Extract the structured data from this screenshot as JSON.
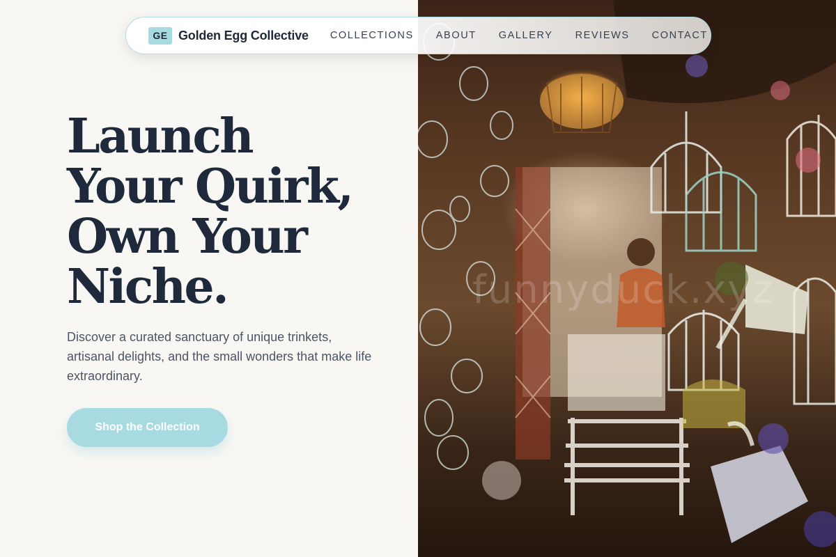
{
  "brand": {
    "logo_text": "GE",
    "name": "Golden Egg Collective",
    "accent_color": "#a8dae2"
  },
  "nav": {
    "links": [
      {
        "label": "COLLECTIONS"
      },
      {
        "label": "ABOUT"
      },
      {
        "label": "GALLERY"
      },
      {
        "label": "REVIEWS"
      },
      {
        "label": "CONTACT"
      }
    ]
  },
  "hero": {
    "headline_lines": [
      "Launch",
      "Your Quirk,",
      "Own Your",
      "Niche."
    ],
    "subtext": "Discover a curated sanctuary of unique trinkets, artisanal delights, and the small wonders that make life extraordinary.",
    "cta_label": "Shop the Collection",
    "image_watermark": "funnyduck.xyz",
    "image_icon": "birdcage-shop-photo"
  },
  "colors": {
    "background": "#f9f7f3",
    "headline": "#1e293b",
    "body_text": "#4b5563"
  }
}
